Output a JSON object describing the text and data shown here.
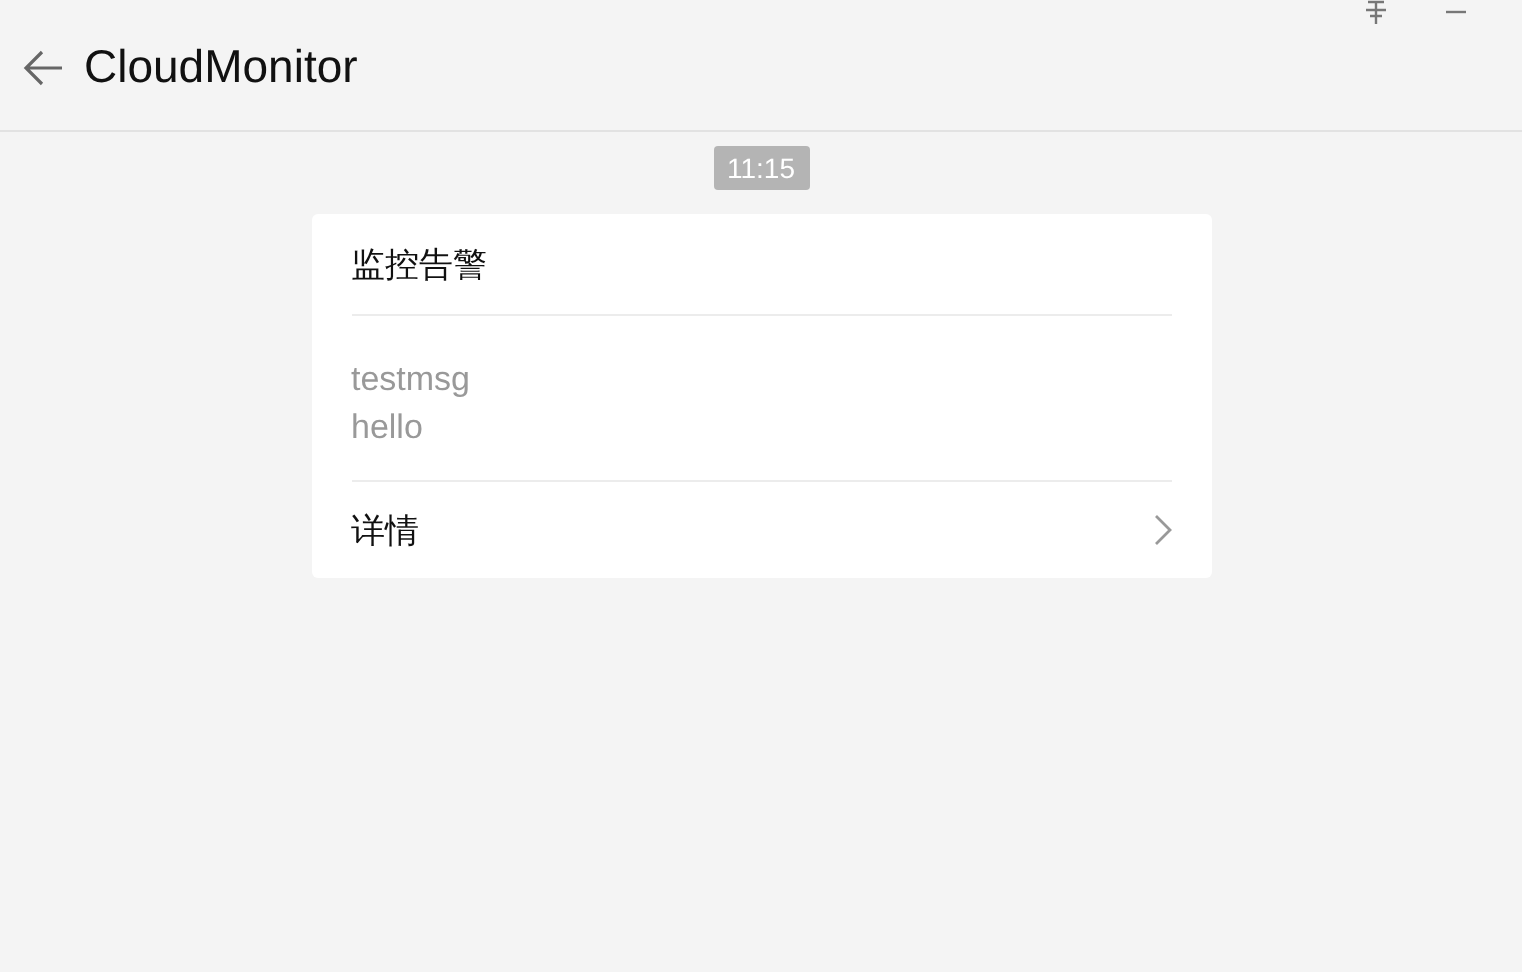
{
  "header": {
    "title": "CloudMonitor"
  },
  "time": "11:15",
  "card": {
    "title": "监控告警",
    "lines": [
      "testmsg",
      "hello"
    ],
    "link": "详情"
  }
}
